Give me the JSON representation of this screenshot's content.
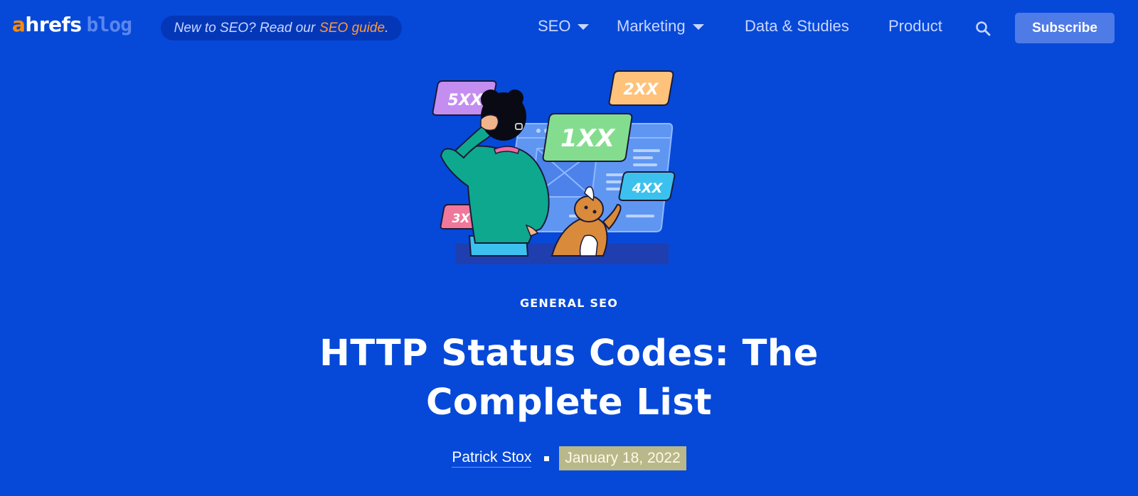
{
  "header": {
    "logo": {
      "part_a": "a",
      "part_hrefs": "hrefs",
      "part_blog": "blog"
    },
    "promo": {
      "text": "New to SEO? Read our",
      "link_label": "SEO guide",
      "suffix": "."
    },
    "nav": [
      {
        "label": "SEO",
        "has_dropdown": true
      },
      {
        "label": "Marketing",
        "has_dropdown": true
      },
      {
        "label": "Data & Studies",
        "has_dropdown": false
      },
      {
        "label": "Product",
        "has_dropdown": false
      }
    ],
    "search_icon": "search-icon",
    "subscribe_label": "Subscribe"
  },
  "hero": {
    "illustration": "person-and-dog-looking-at-status-codes",
    "badges": [
      {
        "label": "5XX",
        "color": "#c48ef0"
      },
      {
        "label": "2XX",
        "color": "#ffc27a"
      },
      {
        "label": "1XX",
        "color": "#84dd8e"
      },
      {
        "label": "4XX",
        "color": "#3cc1ee"
      },
      {
        "label": "3X",
        "color": "#f0789a"
      }
    ]
  },
  "article": {
    "category": "GENERAL SEO",
    "title": "HTTP Status Codes: The Complete List",
    "author": "Patrick Stox",
    "date": "January 18, 2022"
  },
  "colors": {
    "background": "#0649d9",
    "accent_orange": "#ff8a00",
    "nav_text": "#c9d6ff",
    "subscribe_bg": "#4f7be6",
    "date_highlight": "#b8b88a"
  }
}
